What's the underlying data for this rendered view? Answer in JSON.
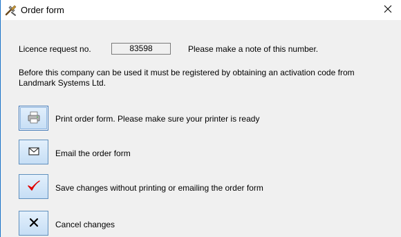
{
  "window": {
    "title": "Order form",
    "close_icon": "close-icon",
    "app_icon": "tools-icon"
  },
  "licence": {
    "label": "Licence request no.",
    "number": "83598",
    "note": "Please make a note of this number."
  },
  "info": {
    "text": "Before this company can be used it must be registered by obtaining an activation code from Landmark Systems Ltd."
  },
  "actions": [
    {
      "icon": "printer-icon",
      "label": "Print order form. Please make sure your printer is ready"
    },
    {
      "icon": "envelope-icon",
      "label": "Email the order form"
    },
    {
      "icon": "checkmark-icon",
      "label": "Save changes without printing or emailing the order form"
    },
    {
      "icon": "cross-icon",
      "label": "Cancel changes"
    }
  ],
  "colors": {
    "accent_border": "#1a73c9",
    "button_fill": "#c6def5",
    "checkmark": "#e00000"
  }
}
